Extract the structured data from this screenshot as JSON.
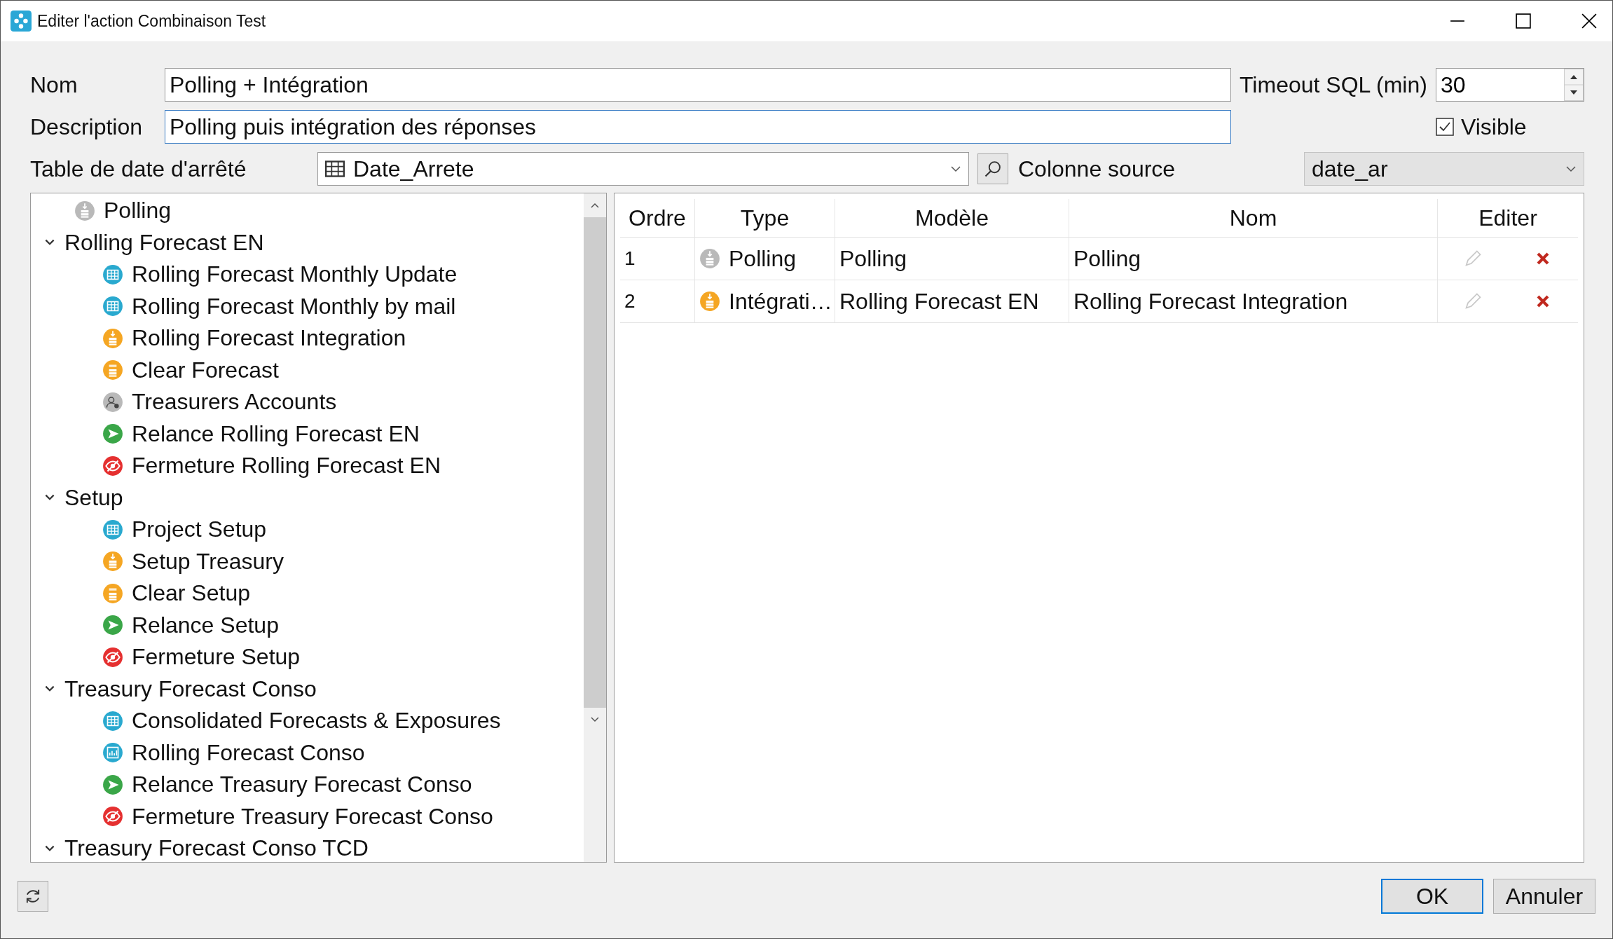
{
  "window": {
    "title": "Editer l'action Combinaison Test"
  },
  "form": {
    "nom_label": "Nom",
    "nom_value": "Polling + Intégration",
    "timeout_label": "Timeout SQL (min)",
    "timeout_value": "30",
    "description_label": "Description",
    "description_value": "Polling puis intégration des réponses",
    "visible": {
      "label": "Visible",
      "checked": true
    },
    "date_table_label": "Table de date d'arrêté",
    "date_table_value": "Date_Arrete",
    "source_column_label": "Colonne source",
    "source_column_value": "date_ar"
  },
  "tree": [
    {
      "label": "Polling",
      "kind": "polling"
    },
    {
      "label": "Rolling Forecast EN",
      "expanded": true,
      "children": [
        {
          "label": "Rolling Forecast Monthly Update",
          "kind": "table"
        },
        {
          "label": "Rolling Forecast Monthly by mail",
          "kind": "table"
        },
        {
          "label": "Rolling Forecast Integration",
          "kind": "integration"
        },
        {
          "label": "Clear Forecast",
          "kind": "sql"
        },
        {
          "label": "Treasurers Accounts",
          "kind": "users"
        },
        {
          "label": "Relance Rolling Forecast EN",
          "kind": "send"
        },
        {
          "label": "Fermeture Rolling Forecast EN",
          "kind": "hide"
        }
      ]
    },
    {
      "label": "Setup",
      "expanded": true,
      "children": [
        {
          "label": "Project Setup",
          "kind": "table"
        },
        {
          "label": "Setup Treasury",
          "kind": "integration"
        },
        {
          "label": "Clear Setup",
          "kind": "sql"
        },
        {
          "label": "Relance Setup",
          "kind": "send"
        },
        {
          "label": "Fermeture Setup",
          "kind": "hide"
        }
      ]
    },
    {
      "label": "Treasury Forecast Conso",
      "expanded": true,
      "children": [
        {
          "label": "Consolidated Forecasts & Exposures",
          "kind": "table"
        },
        {
          "label": "Rolling Forecast Conso",
          "kind": "chart"
        },
        {
          "label": "Relance Treasury Forecast Conso",
          "kind": "send"
        },
        {
          "label": "Fermeture Treasury Forecast Conso",
          "kind": "hide"
        }
      ]
    },
    {
      "label": "Treasury Forecast Conso TCD",
      "expanded": true
    }
  ],
  "table": {
    "columns": [
      "Ordre",
      "Type",
      "Modèle",
      "Nom",
      "Editer"
    ],
    "rows": [
      {
        "ordre": "1",
        "type": "Polling",
        "kind": "polling",
        "modele": "Polling",
        "nom": "Polling"
      },
      {
        "ordre": "2",
        "type": "Intégrati…",
        "kind": "integration",
        "modele": "Rolling Forecast EN",
        "nom": "Rolling Forecast Integration"
      }
    ]
  },
  "buttons": [
    {
      "label": "OK",
      "kind": "default"
    },
    {
      "label": "Annuler",
      "kind": "normal"
    }
  ]
}
